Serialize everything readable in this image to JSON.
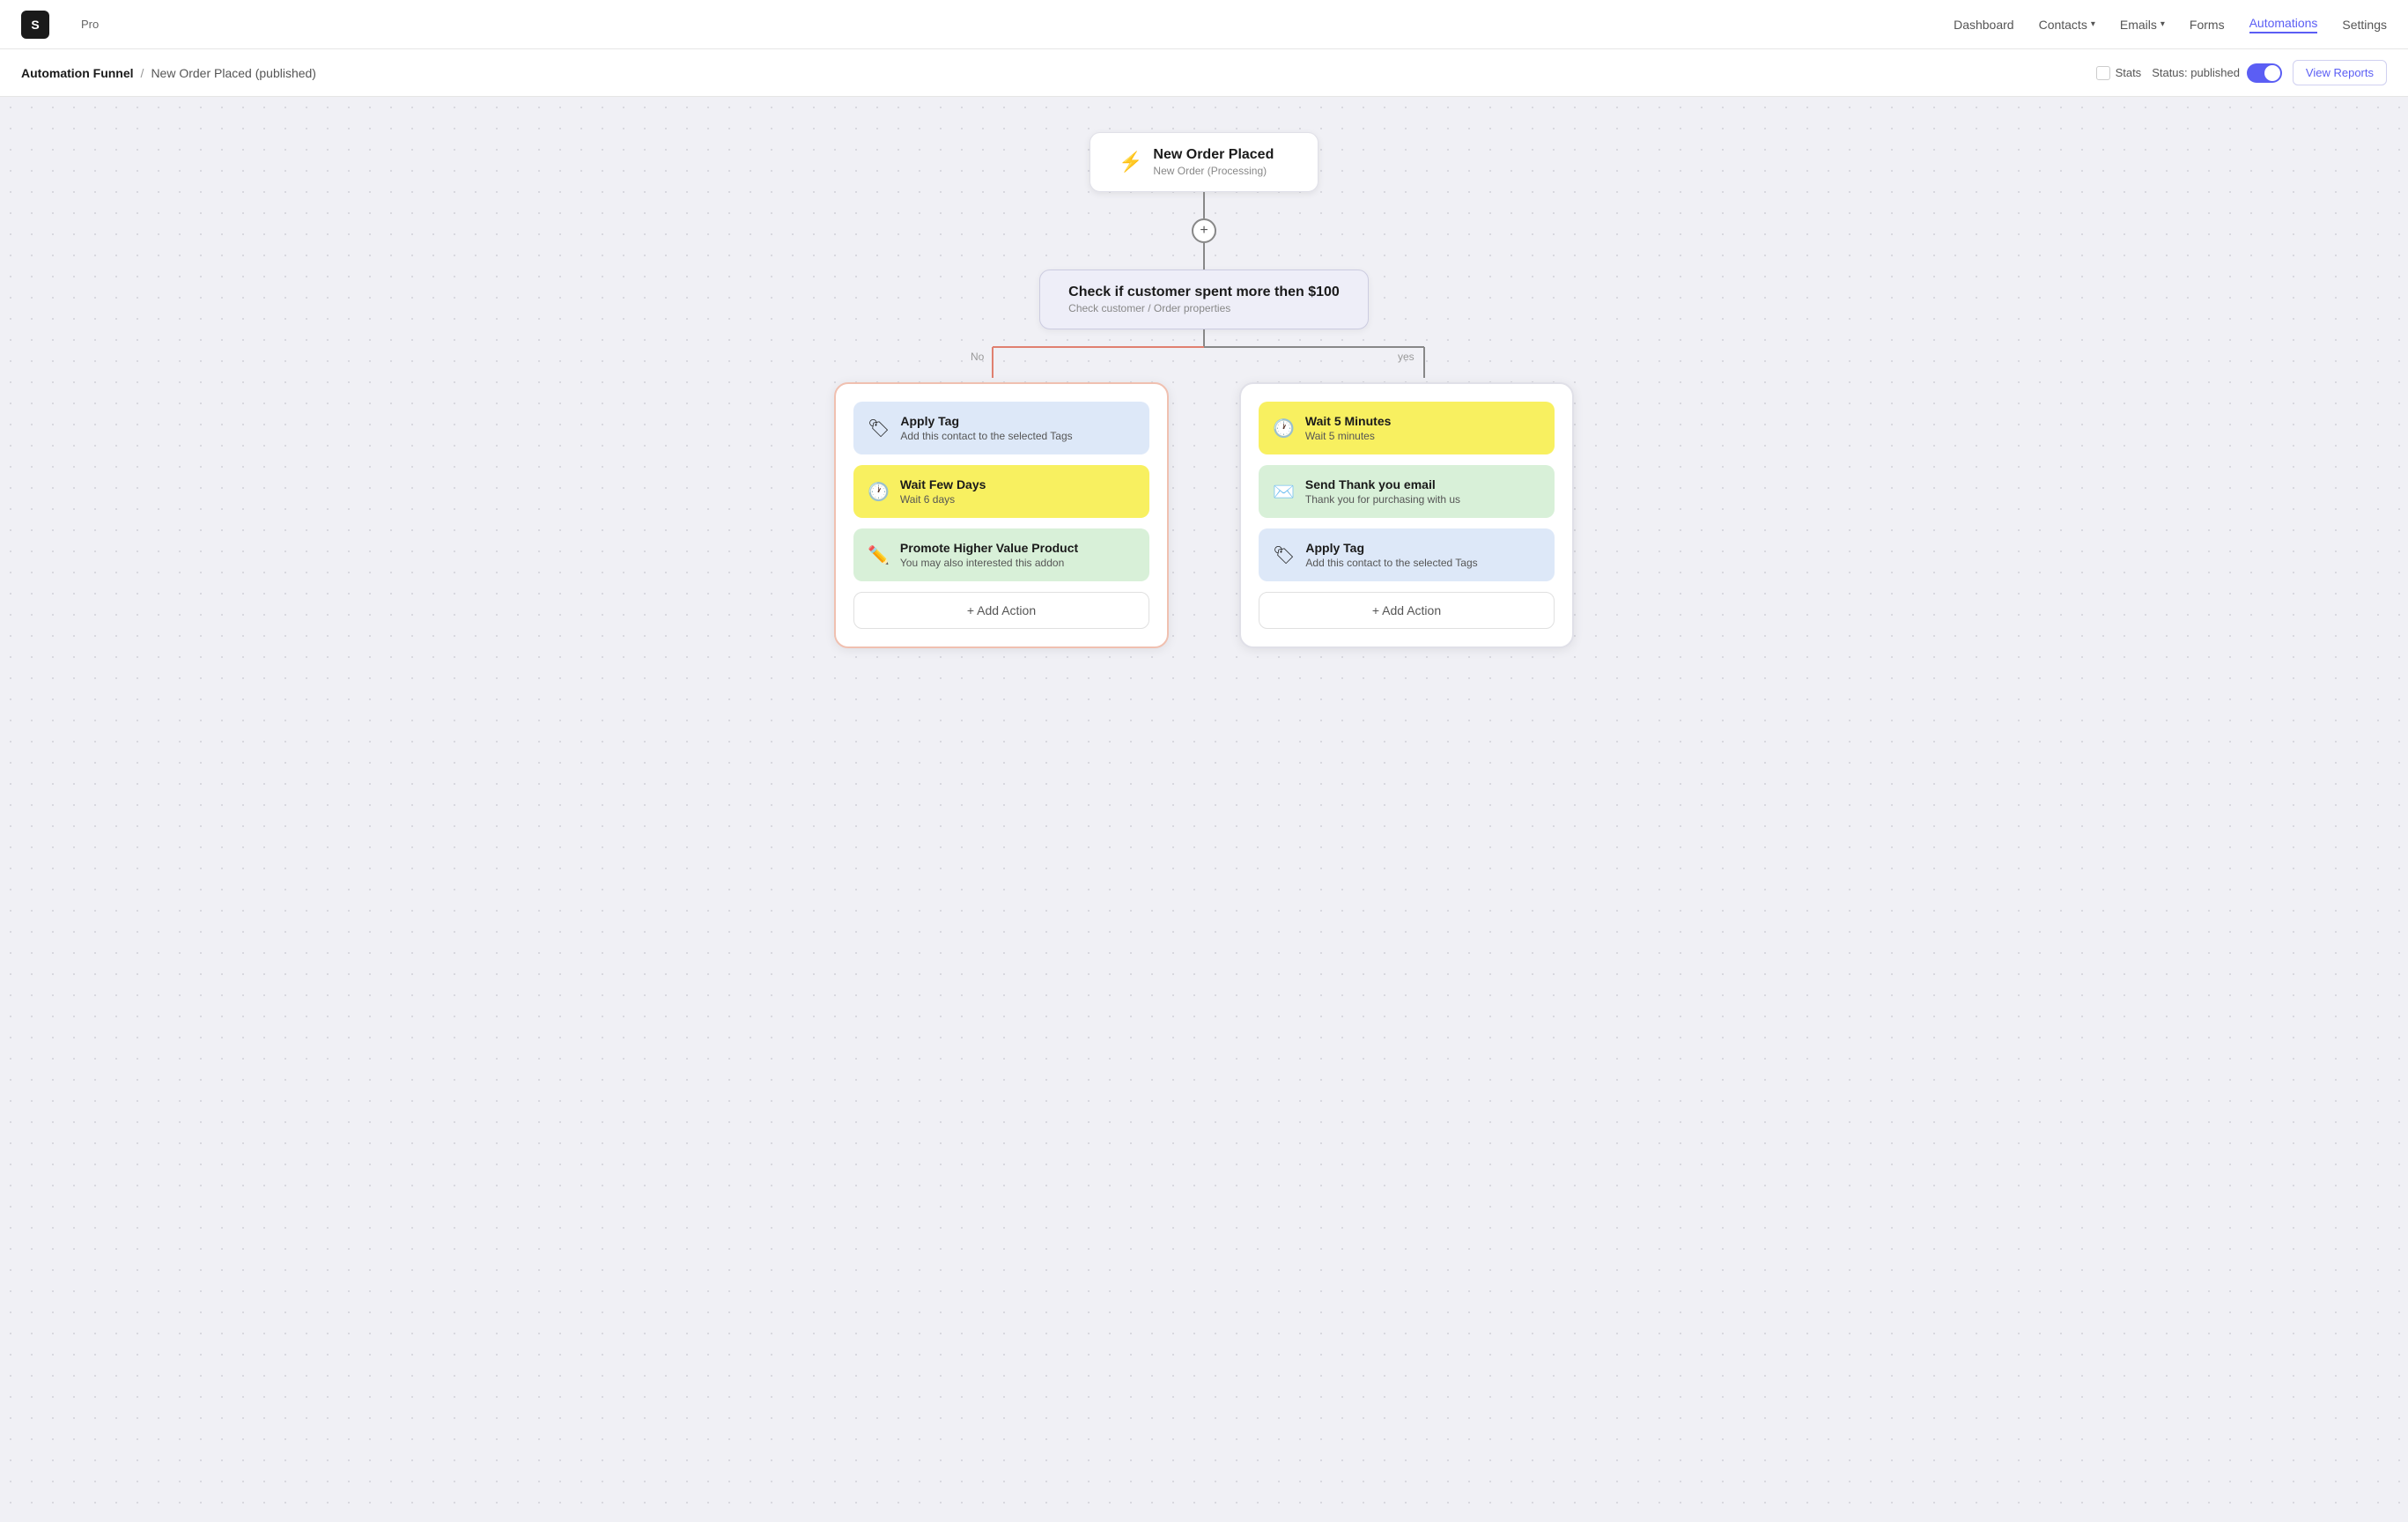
{
  "app": {
    "logo_text": "S",
    "pro_label": "Pro"
  },
  "nav": {
    "links": [
      {
        "label": "Dashboard",
        "active": false
      },
      {
        "label": "Contacts",
        "active": false,
        "has_dropdown": true
      },
      {
        "label": "Emails",
        "active": false,
        "has_dropdown": true
      },
      {
        "label": "Forms",
        "active": false
      },
      {
        "label": "Automations",
        "active": true
      },
      {
        "label": "Settings",
        "active": false
      }
    ]
  },
  "breadcrumb": {
    "root": "Automation Funnel",
    "separator": "/",
    "current": "New Order Placed (published)"
  },
  "toolbar": {
    "stats_label": "Stats",
    "status_label": "Status: published",
    "view_reports_label": "View Reports"
  },
  "canvas": {
    "trigger": {
      "icon": "⚡",
      "title": "New Order Placed",
      "subtitle": "New Order (Processing)"
    },
    "condition": {
      "title": "Check if customer spent more then $100",
      "subtitle": "Check customer / Order properties"
    },
    "branch_no_label": "No",
    "branch_yes_label": "yes",
    "left_branch": {
      "actions": [
        {
          "icon": "🏷",
          "title": "Apply Tag",
          "subtitle": "Add this contact to the selected Tags",
          "color": "blue"
        },
        {
          "icon": "🕐",
          "title": "Wait Few Days",
          "subtitle": "Wait 6 days",
          "color": "yellow"
        },
        {
          "icon": "✏️",
          "title": "Promote Higher Value Product",
          "subtitle": "You may also interested this addon",
          "color": "green"
        }
      ],
      "add_action_label": "+ Add Action"
    },
    "right_branch": {
      "actions": [
        {
          "icon": "🕐",
          "title": "Wait 5 Minutes",
          "subtitle": "Wait 5 minutes",
          "color": "yellow"
        },
        {
          "icon": "✉️",
          "title": "Send Thank you email",
          "subtitle": "Thank you for purchasing with us",
          "color": "green"
        },
        {
          "icon": "🏷",
          "title": "Apply Tag",
          "subtitle": "Add this contact to the selected Tags",
          "color": "blue"
        }
      ],
      "add_action_label": "+ Add Action"
    }
  }
}
